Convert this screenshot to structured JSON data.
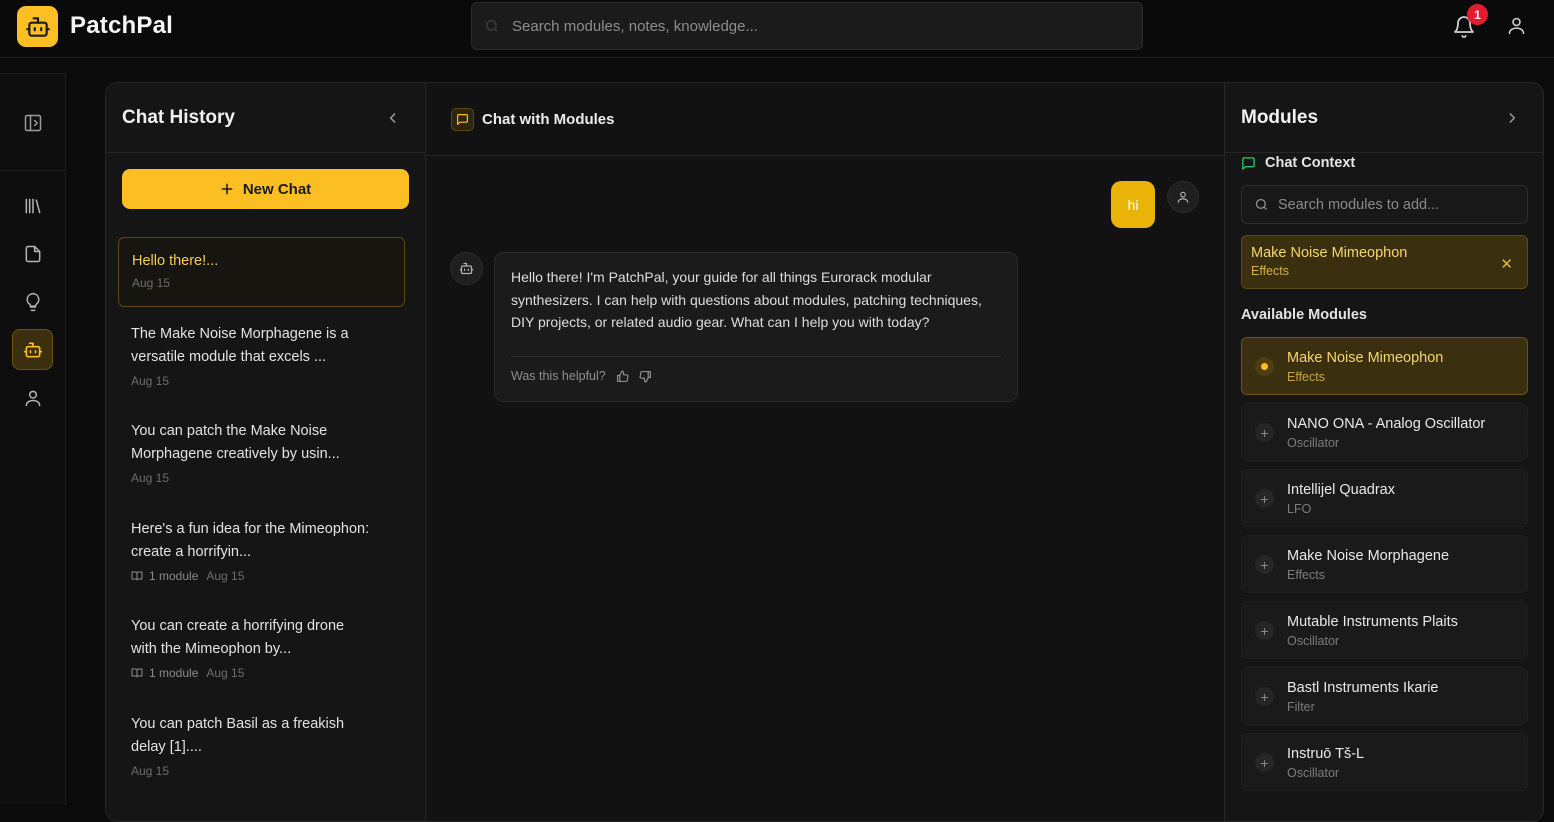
{
  "app": {
    "name": "PatchPal"
  },
  "search": {
    "placeholder": "Search modules, notes, knowledge..."
  },
  "notifications": {
    "count": "1"
  },
  "icons": {
    "logo": "robot-icon",
    "sidebar": [
      "sidebar-toggle-icon",
      "library-icon",
      "document-icon",
      "lightbulb-icon",
      "robot-icon",
      "user-icon"
    ]
  },
  "colors": {
    "accent": "#fbbf24",
    "badge": "#e11d2e",
    "context_icon": "#22c55e"
  },
  "history": {
    "title": "Chat History",
    "new_chat": "New Chat",
    "items": [
      {
        "text": "Hello there!...",
        "date": "Aug 15",
        "modules": ""
      },
      {
        "text": "The Make Noise Morphagene is a versatile module that excels ...",
        "date": "Aug 15",
        "modules": ""
      },
      {
        "text": "You can patch the Make Noise Morphagene creatively by usin...",
        "date": "Aug 15",
        "modules": ""
      },
      {
        "text": "Here's a fun idea for the Mimeophon: create a horrifyin...",
        "date": "Aug 15",
        "modules": "1 module"
      },
      {
        "text": "You can create a horrifying drone with the Mimeophon by...",
        "date": "Aug 15",
        "modules": "1 module"
      },
      {
        "text": "You can patch Basil as a freakish delay [1]....",
        "date": "Aug 15",
        "modules": ""
      }
    ]
  },
  "chat": {
    "title": "Chat with Modules",
    "user_message": "hi",
    "bot_message": "Hello there! I'm PatchPal, your guide for all things Eurorack modular synthesizers. I can help with questions about modules, patching techniques, DIY projects, or related audio gear. What can I help you with today?",
    "feedback_prompt": "Was this helpful?"
  },
  "modules": {
    "title": "Modules",
    "context_label": "Chat Context",
    "search_placeholder": "Search modules to add...",
    "context": [
      {
        "name": "Make Noise Mimeophon",
        "category": "Effects"
      }
    ],
    "available_label": "Available Modules",
    "available": [
      {
        "name": "Make Noise Mimeophon",
        "category": "Effects",
        "selected": true
      },
      {
        "name": "NANO ONA - Analog Oscillator",
        "category": "Oscillator",
        "selected": false
      },
      {
        "name": "Intellijel Quadrax",
        "category": "LFO",
        "selected": false
      },
      {
        "name": "Make Noise Morphagene",
        "category": "Effects",
        "selected": false
      },
      {
        "name": "Mutable Instruments Plaits",
        "category": "Oscillator",
        "selected": false
      },
      {
        "name": "Bastl Instruments Ikarie",
        "category": "Filter",
        "selected": false
      },
      {
        "name": "Instruō Tš-L",
        "category": "Oscillator",
        "selected": false
      }
    ]
  }
}
